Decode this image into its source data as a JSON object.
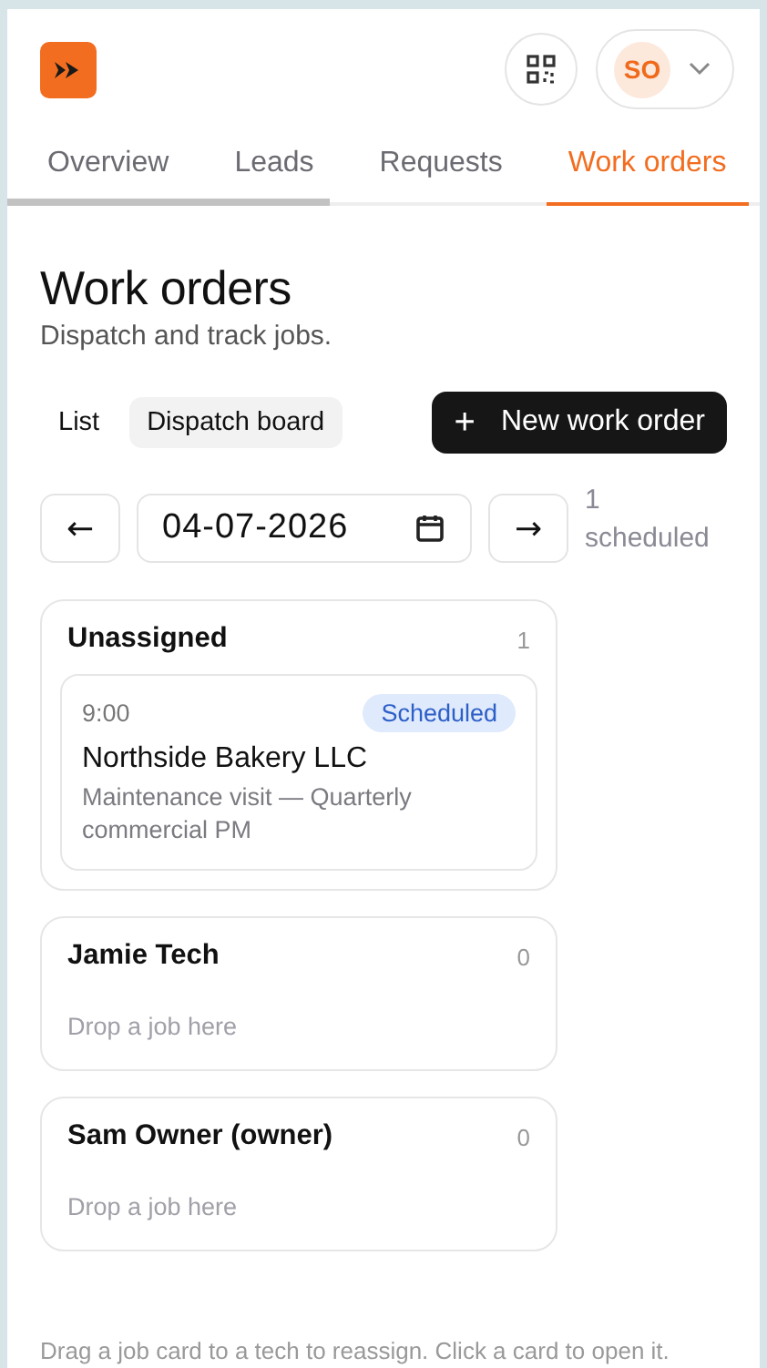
{
  "header": {
    "avatar_initials": "SO"
  },
  "tabs": [
    {
      "label": "Overview",
      "selected": false
    },
    {
      "label": "Leads",
      "selected": false
    },
    {
      "label": "Requests",
      "selected": false
    },
    {
      "label": "Work orders",
      "selected": true
    }
  ],
  "page": {
    "title": "Work orders",
    "subtitle": "Dispatch and track jobs."
  },
  "views": [
    {
      "label": "List",
      "selected": false
    },
    {
      "label": "Dispatch board",
      "selected": true
    }
  ],
  "new_button": {
    "icon": "+",
    "label": "New work order"
  },
  "date_nav": {
    "prev": "←",
    "date": "04-07-2026",
    "next": "→",
    "count": "1",
    "count_label": "scheduled"
  },
  "columns": [
    {
      "name": "Unassigned",
      "count": "1",
      "jobs": [
        {
          "time": "9:00",
          "status": "Scheduled",
          "customer": "Northside Bakery LLC",
          "description": "Maintenance visit — Quarterly commercial PM"
        }
      ]
    },
    {
      "name": "Jamie Tech",
      "count": "0",
      "empty": "Drop a job here"
    },
    {
      "name": "Sam Owner (owner)",
      "count": "0",
      "empty": "Drop a job here"
    }
  ],
  "footer_hint": "Drag a job card to a tech to reassign. Click a card to open it."
}
